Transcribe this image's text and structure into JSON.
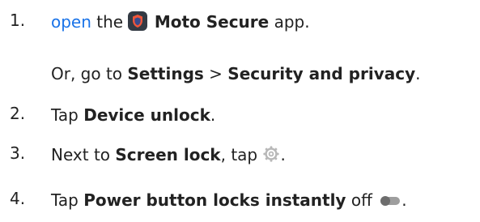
{
  "steps": [
    {
      "number": "1.",
      "parts": {
        "link": "open",
        "t1": " the ",
        "app_name": "Moto Secure",
        "t2": " app."
      },
      "alt": {
        "t1": "Or, go to ",
        "settings": "Settings",
        "sep": " > ",
        "section": "Security and privacy",
        "t2": "."
      }
    },
    {
      "number": "2.",
      "parts": {
        "t1": "Tap ",
        "target": "Device unlock",
        "t2": "."
      }
    },
    {
      "number": "3.",
      "parts": {
        "t1": "Next to ",
        "target": "Screen lock",
        "t2": ", tap ",
        "t3": "."
      }
    },
    {
      "number": "4.",
      "parts": {
        "t1": "Tap ",
        "target": "Power button locks instantly",
        "t2": " off ",
        "t3": "."
      }
    }
  ],
  "icons": {
    "app_icon": "moto-secure-app-icon",
    "gear": "settings-gear-icon",
    "toggle": "toggle-off-icon"
  },
  "colors": {
    "text": "#222222",
    "link": "#1a73e8",
    "app_icon_bg": "#333a44",
    "shield_outer": "#f0563a",
    "shield_inner": "#3b4a8c",
    "gear": "#b8b8b8",
    "toggle_track": "#9e9e9e",
    "toggle_knob": "#6d6d6d"
  }
}
